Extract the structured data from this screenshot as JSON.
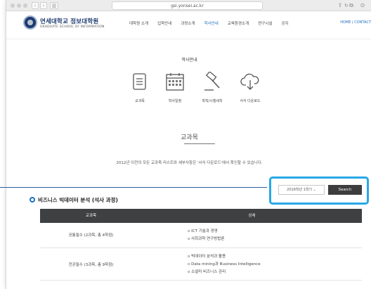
{
  "browser": {
    "url": "gsi.yonsei.ac.kr",
    "reload_icon": "reload-icon",
    "back": "‹",
    "forward": "›"
  },
  "header": {
    "logo_name": "연세대학교 정보대학원",
    "logo_sub": "GRADUATE SCHOOL OF INFORMATION",
    "nav": [
      "대학원 소개",
      "입학안내",
      "과정소개",
      "학사안내",
      "교육환경소개",
      "연구시설",
      "공지"
    ],
    "active_nav_index": 3,
    "util": "HOME | CONTACT"
  },
  "quick_menu": {
    "title": "학사안내",
    "items": [
      {
        "label": "교과목",
        "icon": "book-icon"
      },
      {
        "label": "학사일정",
        "icon": "calendar-icon"
      },
      {
        "label": "학칙/시행세칙",
        "icon": "gavel-icon"
      },
      {
        "label": "서식 다운로드",
        "icon": "cloud-download-icon"
      }
    ]
  },
  "content": {
    "heading": "교과목",
    "notice": "2012년 이전의 모든 교과목 리스트와 세부사항은 '서식 다운로드'에서 확인할 수 있습니다.",
    "filter": {
      "selected": "2016학년 1학기 ⌄",
      "search_label": "Search"
    },
    "track_title": "비즈니스 빅데이터 분석 (석사 과정)",
    "table": {
      "headers": [
        "교과목",
        "상세"
      ],
      "rows": [
        {
          "category": "공통필수 (2과목, 총 4학점)",
          "courses": [
            "ICT 기술과 경영",
            "사회과학 연구방법론"
          ]
        },
        {
          "category": "전공필수 (3과목, 총 9학점)",
          "courses": [
            "빅데이터 분석과 활용",
            "Data mining과 Business Intelligence",
            "소셜미 비즈니스 관리"
          ]
        }
      ]
    }
  },
  "colors": {
    "brand": "#1d3a6f",
    "accent": "#1d6fbe",
    "callout": "#27a8e6",
    "table_header": "#3e4042",
    "search_button": "#3d3d3d"
  }
}
